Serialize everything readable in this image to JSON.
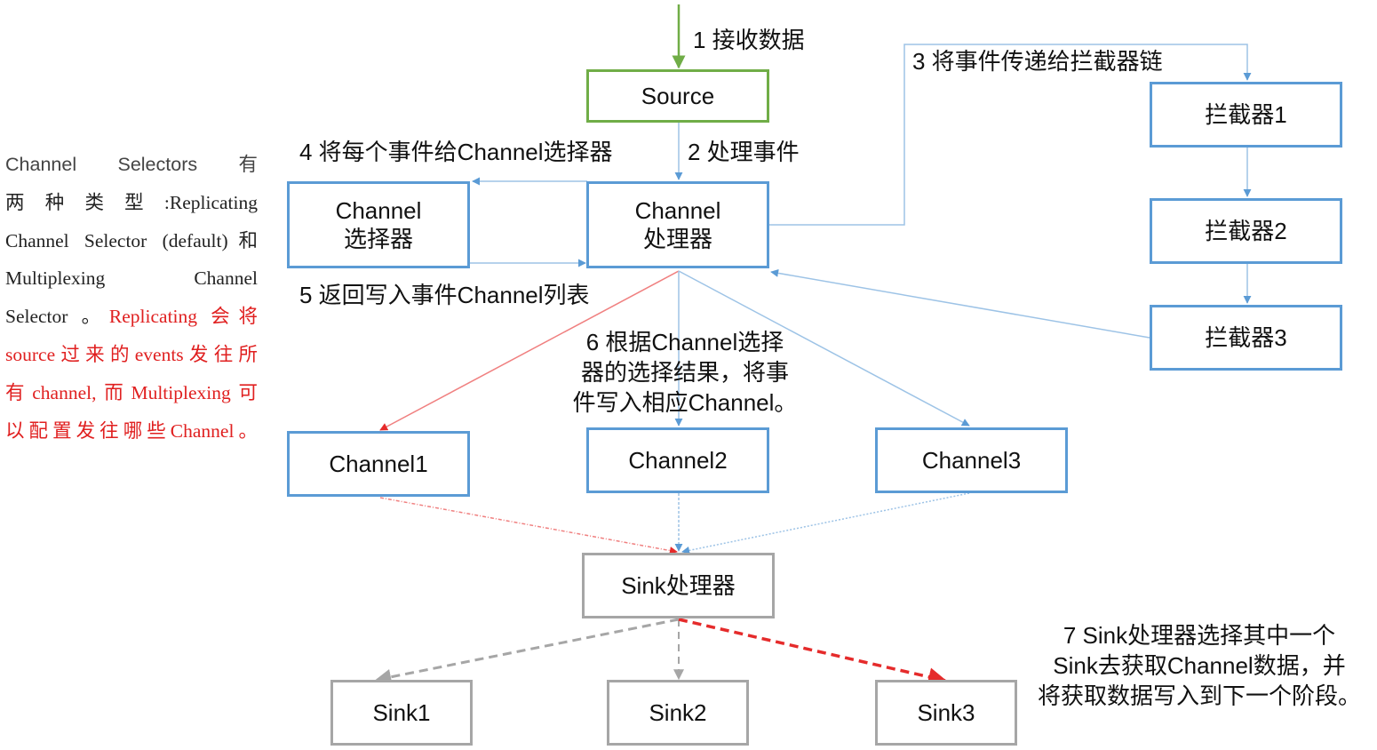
{
  "colors": {
    "blue": "#5b9bd5",
    "green": "#70ad47",
    "gray": "#a6a6a6",
    "red": "#e52b2b"
  },
  "side_note": {
    "lines": [
      {
        "parts": [
          {
            "text": "Channel   Selectors 有",
            "style": "sans"
          }
        ]
      },
      {
        "parts": [
          {
            "text": "两 种 类 型 :Replicating",
            "style": "normal"
          }
        ]
      },
      {
        "parts": [
          {
            "text": "Channel Selector (default)和",
            "style": "normal"
          }
        ]
      },
      {
        "parts": [
          {
            "text": "Multiplexing        Channel",
            "style": "normal"
          }
        ]
      },
      {
        "parts": [
          {
            "text": "Selector 。",
            "style": "normal"
          },
          {
            "text": "Replicating 会将",
            "style": "red"
          }
        ]
      },
      {
        "parts": [
          {
            "text": "source过来的events发往所",
            "style": "red"
          }
        ]
      },
      {
        "parts": [
          {
            "text": "有channel,而Multiplexing可",
            "style": "red"
          }
        ]
      },
      {
        "parts": [
          {
            "text": "以配置发往哪些Channel。",
            "style": "red"
          }
        ]
      }
    ]
  },
  "nodes": {
    "source": "Source",
    "channel_selector": [
      "Channel",
      "选择器"
    ],
    "channel_processor": [
      "Channel",
      "处理器"
    ],
    "interceptor1": "拦截器1",
    "interceptor2": "拦截器2",
    "interceptor3": "拦截器3",
    "channel1": "Channel1",
    "channel2": "Channel2",
    "channel3": "Channel3",
    "sink_processor": "Sink处理器",
    "sink1": "Sink1",
    "sink2": "Sink2",
    "sink3": "Sink3"
  },
  "steps": {
    "s1": "1 接收数据",
    "s2": "2 处理事件",
    "s3": "3 将事件传递给拦截器链",
    "s4": "4 将每个事件给Channel选择器",
    "s5": "5 返回写入事件Channel列表",
    "s6": [
      "6 根据Channel选择",
      "器的选择结果，将事",
      "件写入相应Channel。"
    ],
    "s7": [
      "7 Sink处理器选择其中一个",
      "Sink去获取Channel数据，并",
      "将获取数据写入到下一个阶段。"
    ]
  }
}
